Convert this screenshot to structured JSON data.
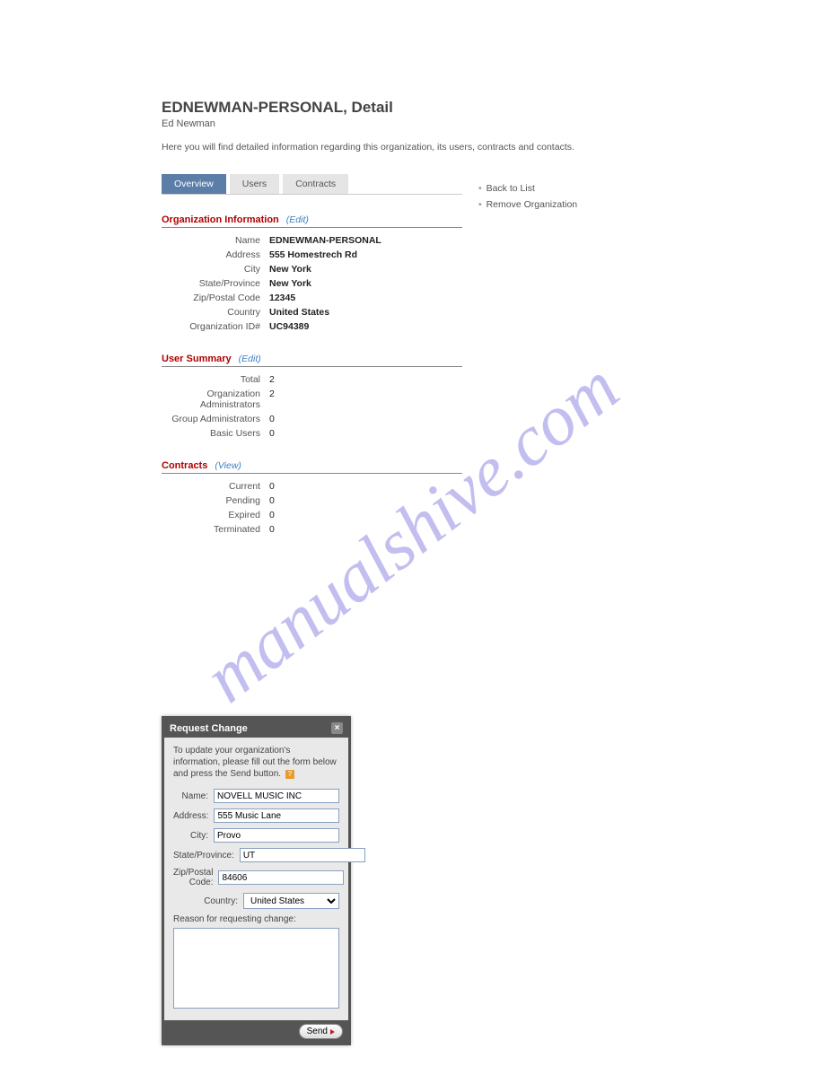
{
  "watermark": "manualshive.com",
  "header": {
    "title": "EDNEWMAN-PERSONAL, Detail",
    "subtitle": "Ed Newman",
    "description": "Here you will find detailed information regarding this organization, its users, contracts and contacts."
  },
  "tabs": [
    {
      "label": "Overview",
      "active": true
    },
    {
      "label": "Users",
      "active": false
    },
    {
      "label": "Contracts",
      "active": false
    }
  ],
  "sidelinks": {
    "back": "Back to List",
    "remove": "Remove Organization"
  },
  "sections": {
    "org_info": {
      "title": "Organization Information",
      "action": "(Edit)",
      "rows": [
        {
          "label": "Name",
          "value": "EDNEWMAN-PERSONAL"
        },
        {
          "label": "Address",
          "value": "555 Homestrech Rd"
        },
        {
          "label": "City",
          "value": "New York"
        },
        {
          "label": "State/Province",
          "value": "New York"
        },
        {
          "label": "Zip/Postal Code",
          "value": "12345"
        },
        {
          "label": "Country",
          "value": "United States"
        },
        {
          "label": "Organization ID#",
          "value": "UC94389"
        }
      ]
    },
    "user_summary": {
      "title": "User Summary",
      "action": "(Edit)",
      "rows": [
        {
          "label": "Total",
          "value": "2"
        },
        {
          "label": "Organization Administrators",
          "value": "2"
        },
        {
          "label": "Group Administrators",
          "value": "0"
        },
        {
          "label": "Basic Users",
          "value": "0"
        }
      ]
    },
    "contracts": {
      "title": "Contracts",
      "action": "(View)",
      "rows": [
        {
          "label": "Current",
          "value": "0"
        },
        {
          "label": "Pending",
          "value": "0"
        },
        {
          "label": "Expired",
          "value": "0"
        },
        {
          "label": "Terminated",
          "value": "0"
        }
      ]
    }
  },
  "dialog": {
    "title": "Request Change",
    "intro": "To update your organization's information, please fill out the form below and press the Send button.",
    "help_glyph": "?",
    "fields": {
      "name": {
        "label": "Name:",
        "value": "NOVELL MUSIC INC"
      },
      "address": {
        "label": "Address:",
        "value": "555 Music Lane"
      },
      "city": {
        "label": "City:",
        "value": "Provo"
      },
      "state": {
        "label": "State/Province:",
        "value": "UT"
      },
      "zip": {
        "label": "Zip/Postal Code:",
        "value": "84606"
      },
      "country": {
        "label": "Country:",
        "value": "United States"
      }
    },
    "reason_label": "Reason for requesting change:",
    "reason_value": "",
    "send_label": "Send",
    "close_glyph": "×"
  }
}
